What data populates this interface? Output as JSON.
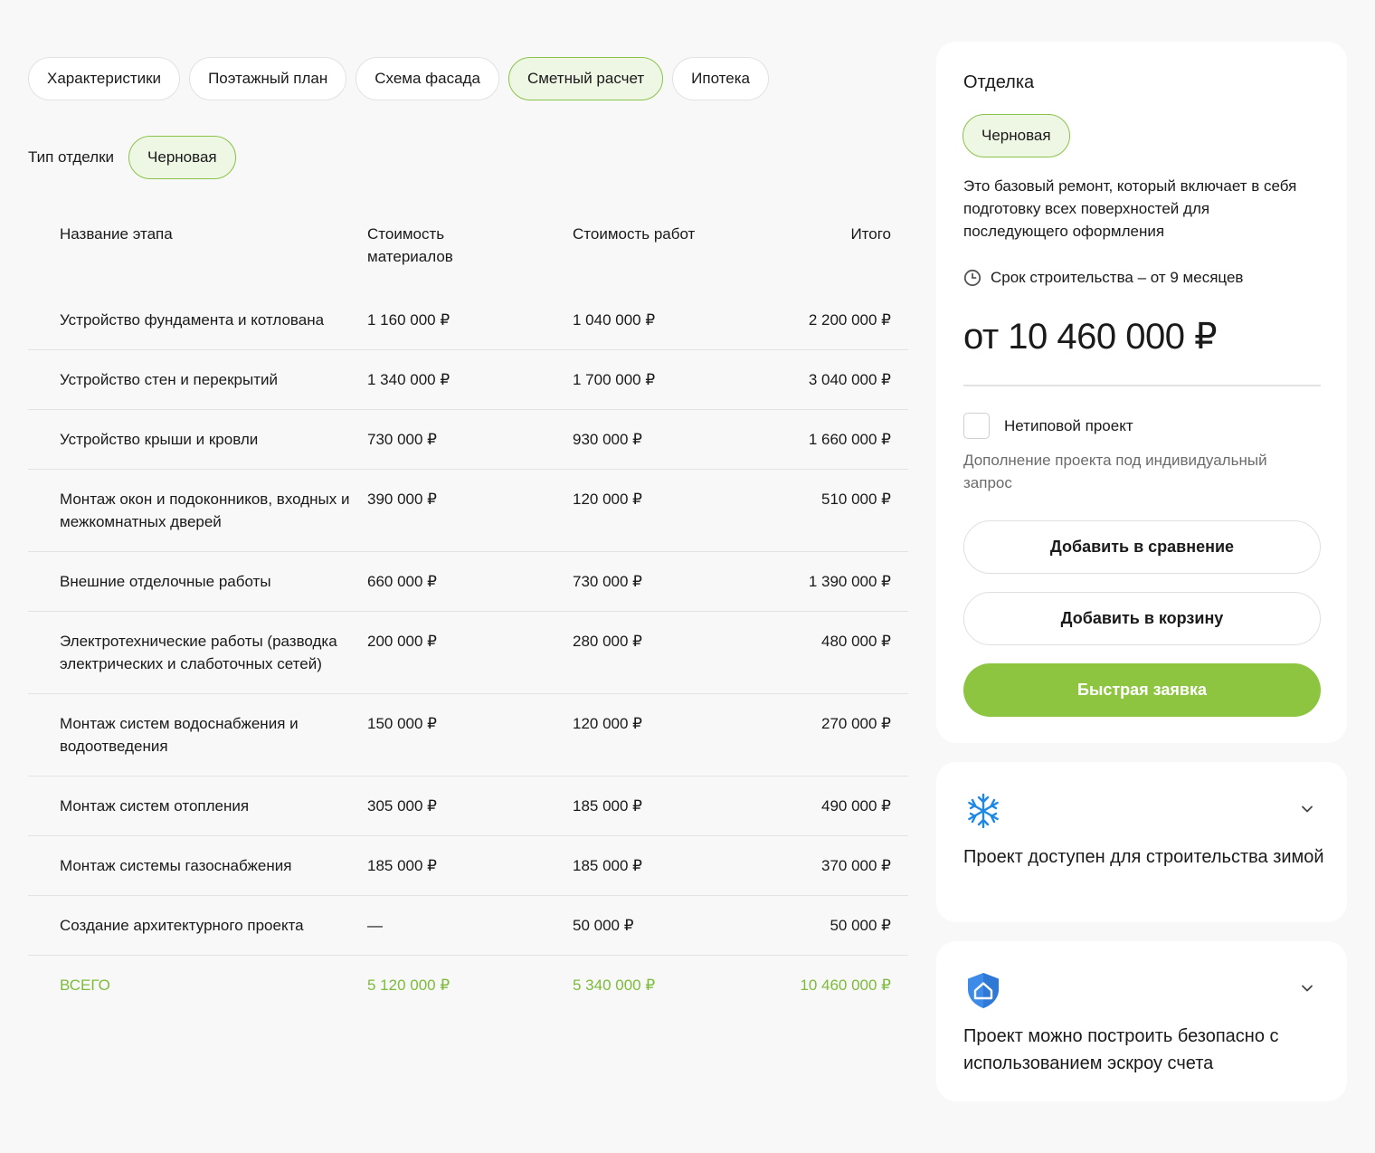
{
  "tabs": [
    {
      "label": "Характеристики"
    },
    {
      "label": "Поэтажный план"
    },
    {
      "label": "Схема фасада"
    },
    {
      "label": "Сметный расчет"
    },
    {
      "label": "Ипотека"
    }
  ],
  "active_tab_index": 3,
  "finish_type": {
    "label": "Тип отделки",
    "value": "Черновая"
  },
  "table": {
    "headers": [
      "Название этапа",
      "Стоимость материалов",
      "Стоимость работ",
      "Итого"
    ],
    "rows": [
      [
        "Устройство фундамента и котлована",
        "1 160 000 ₽",
        "1 040 000 ₽",
        "2 200 000 ₽"
      ],
      [
        "Устройство стен и перекрытий",
        "1 340 000 ₽",
        "1 700 000 ₽",
        "3 040 000 ₽"
      ],
      [
        "Устройство крыши и кровли",
        "730 000 ₽",
        "930 000 ₽",
        "1 660 000 ₽"
      ],
      [
        "Монтаж окон и подоконников, входных и межкомнатных дверей",
        "390 000 ₽",
        "120 000 ₽",
        "510 000 ₽"
      ],
      [
        "Внешние отделочные работы",
        "660 000 ₽",
        "730 000 ₽",
        "1 390 000 ₽"
      ],
      [
        "Электротехнические работы (разводка электрических и слаботочных сетей)",
        "200 000 ₽",
        "280 000 ₽",
        "480 000 ₽"
      ],
      [
        "Монтаж систем водоснабжения и водоотведения",
        "150 000 ₽",
        "120 000 ₽",
        "270 000 ₽"
      ],
      [
        "Монтаж систем отопления",
        "305 000 ₽",
        "185 000 ₽",
        "490 000 ₽"
      ],
      [
        "Монтаж системы газоснабжения",
        "185 000 ₽",
        "185 000 ₽",
        "370 000 ₽"
      ],
      [
        "Создание архитектурного проекта",
        "—",
        "50 000 ₽",
        "50 000 ₽"
      ]
    ],
    "total": [
      "ВСЕГО",
      "5 120 000 ₽",
      "5 340 000 ₽",
      "10 460 000 ₽"
    ]
  },
  "sidebar": {
    "title": "Отделка",
    "finish": "Черновая",
    "description": "Это базовый ремонт, который включает в себя подготовку всех поверхностей для последующего оформления",
    "term": "Срок строительства – от 9 месяцев",
    "price": "от 10 460 000 ₽",
    "custom_project_label": "Нетиповой проект",
    "custom_project_note": "Дополнение проекта под индивидуальный запрос",
    "compare_button": "Добавить в сравнение",
    "cart_button": "Добавить в корзину",
    "quick_request_button": "Быстрая заявка"
  },
  "info_cards": {
    "winter": "Проект доступен для строительства зимой",
    "escrow": "Проект можно построить безопасно с использованием эскроу счета"
  },
  "colors": {
    "accent": "#8dc540",
    "accent_light": "#eef7e4",
    "snow_icon": "#1e88e5"
  },
  "icons": [
    "clock-icon",
    "snowflake-icon",
    "shield-house-icon",
    "chevron-down-icon"
  ]
}
